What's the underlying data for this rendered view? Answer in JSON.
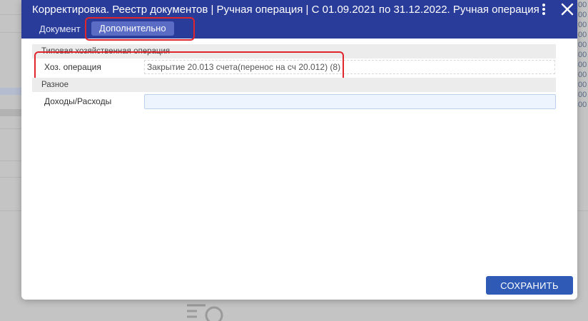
{
  "dialog": {
    "title": "Корректировка. Реестр документов | Ручная операция | С 01.09.2021 по 31.12.2022. Ручная операция",
    "tabs": [
      {
        "label": "Документ"
      },
      {
        "label": "Дополнительно",
        "active": true
      }
    ]
  },
  "sections": {
    "typical": {
      "title": "Типовая хозяйственная операция",
      "op_label": "Хоз. операция",
      "op_value": "Закрытие 20.013 счета(перенос на сч 20.012) (8)"
    },
    "misc": {
      "title": "Разное",
      "income_label": "Доходы/Расходы",
      "income_value": ""
    }
  },
  "buttons": {
    "save": "СОХРАНИТЬ"
  },
  "background": {
    "column_text": "00\n00\n00\n00\n00\n00\n00\n00\n00\n00\n00"
  },
  "colors": {
    "titlebar": "#2a3c9a",
    "accent": "#2f5bb7",
    "highlight": "#e0252c"
  }
}
